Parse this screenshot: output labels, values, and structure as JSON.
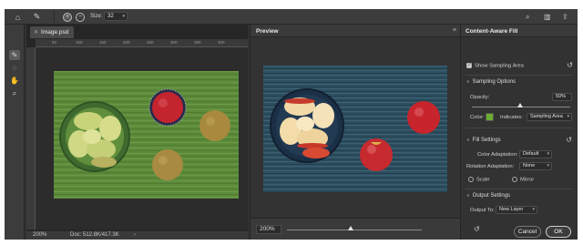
{
  "optionbar": {
    "size_label": "Size:",
    "size_value": "32"
  },
  "toolbox": {
    "tools": [
      "sampling-brush-icon",
      "lasso-icon",
      "hand-icon",
      "zoom-icon"
    ]
  },
  "document": {
    "tab_title": "Image.psd",
    "ruler_ticks": [
      "50",
      "100",
      "150",
      "200",
      "250",
      "300",
      "350",
      "400"
    ],
    "zoom": "200%",
    "doc_size": "Doc: 512.8K/417.3K"
  },
  "preview": {
    "title": "Preview",
    "zoom": "200%",
    "zoom_slider_fraction": 0.47
  },
  "caf": {
    "title": "Content-Aware Fill",
    "show_sampling_area": "Show Sampling Area",
    "sampling_options": "Sampling Options",
    "opacity_label": "Opacity:",
    "opacity_value": "50%",
    "color_label": "Color:",
    "indicates_label": "Indicates:",
    "indicates_value": "Sampling Area",
    "fill_settings": "Fill Settings",
    "color_adaptation_label": "Color Adaptation:",
    "color_adaptation_value": "Default",
    "rotation_adaptation_label": "Rotation Adaptation:",
    "rotation_adaptation_value": "None",
    "scale_label": "Scale",
    "mirror_label": "Mirror",
    "output_settings": "Output Settings",
    "output_to_label": "Output To:",
    "output_to_value": "New Layer",
    "cancel": "Cancel",
    "ok": "OK"
  },
  "colors": {
    "sampling_color": "#6aad2f",
    "panel_bg": "#323232"
  }
}
